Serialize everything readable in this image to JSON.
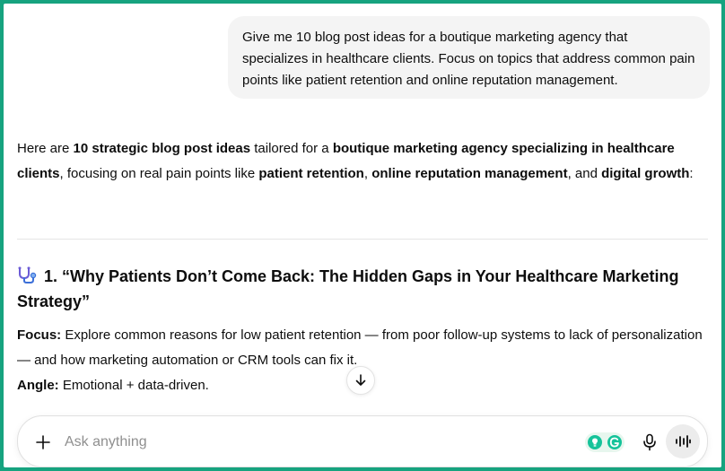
{
  "user_message": "Give me 10 blog post ideas for a boutique marketing agency that specializes in healthcare clients. Focus on topics that address common pain points like patient retention and online reputation management.",
  "intro": {
    "t1": "Here are ",
    "b1": "10 strategic blog post ideas",
    "t2": " tailored for a ",
    "b2": "boutique marketing agency specializing in healthcare clients",
    "t3": ", focusing on real pain points like ",
    "b3": "patient retention",
    "t4": ", ",
    "b4": "online reputation management",
    "t5": ", and ",
    "b5": "digital growth",
    "t6": ":"
  },
  "idea1": {
    "icon": "stethoscope-icon",
    "title": "1. “Why Patients Don’t Come Back: The Hidden Gaps in Your Healthcare Marketing Strategy”",
    "focus_label": "Focus:",
    "focus_text": " Explore common reasons for low patient retention — from poor follow-up systems to lack of personalization — and how marketing automation or CRM tools can fix it.",
    "angle_label": "Angle:",
    "angle_text": " Emotional + data-driven."
  },
  "composer": {
    "placeholder": "Ask anything"
  },
  "colors": {
    "frame": "#16a37f",
    "bubble": "#f4f4f4",
    "grammarly": "#15c39a"
  }
}
